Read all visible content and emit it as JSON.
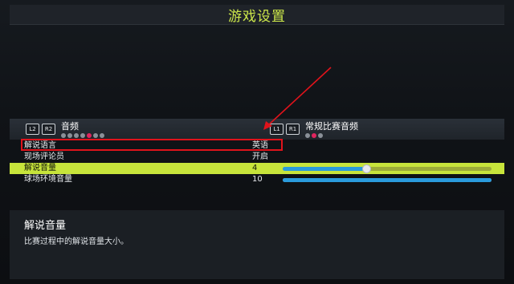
{
  "header": {
    "title": "游戏设置"
  },
  "tabs": {
    "left": {
      "key1": "L2",
      "key2": "R2",
      "label": "音频",
      "dot_count": 7,
      "active_dot_index": 4
    },
    "right": {
      "key1": "L1",
      "key2": "R1",
      "label": "常规比赛音频",
      "dot_count": 3,
      "active_dot_index": 1
    }
  },
  "settings": [
    {
      "label": "解说语言",
      "value": "英语"
    },
    {
      "label": "现场评论员",
      "value": "开启"
    },
    {
      "label": "解说音量",
      "value": "4",
      "slider_fraction": 0.4,
      "fill_fraction": 0.4
    },
    {
      "label": "球场环境音量",
      "value": "10",
      "slider_fraction": 1.0,
      "fill_fraction": 1.0
    }
  ],
  "description": {
    "title": "解说音量",
    "text": "比赛过程中的解说音量大小。"
  },
  "colors": {
    "accent": "#c7e43b",
    "title": "#cde84a",
    "annotation_red": "#e0131b",
    "dot_active": "#e0245e",
    "slider_blue": "#2a9bdc"
  }
}
